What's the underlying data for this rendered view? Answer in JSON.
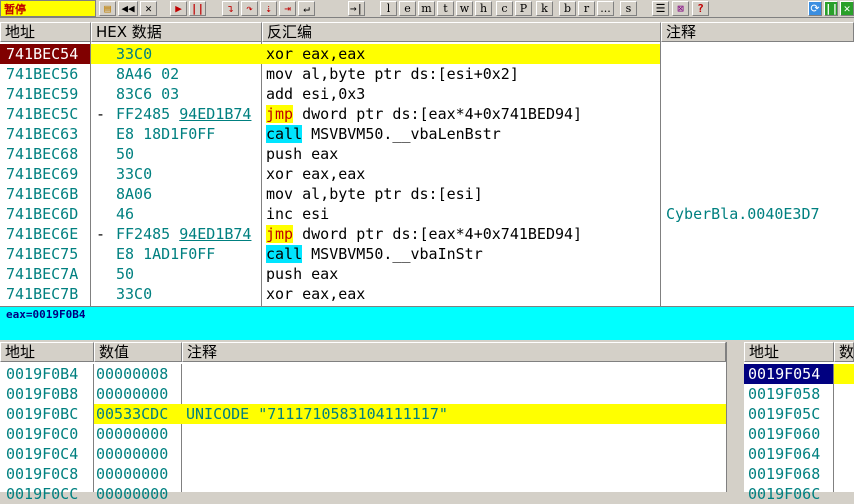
{
  "status_text": "暂停",
  "toolbar": {
    "buttons": [
      "open-icon",
      "rewind-icon",
      "close-icon",
      "run-icon",
      "pause-icon",
      "step-into-icon",
      "step-over-icon",
      "trace-into-icon",
      "trace-over-icon",
      "execute-till-return-icon",
      "go-to-icon"
    ],
    "letters": [
      "l",
      "e",
      "m",
      "t",
      "w",
      "h",
      "c",
      "P",
      "k",
      "b",
      "r",
      "...",
      "s"
    ],
    "right_buttons": [
      "list-icon",
      "grid-icon",
      "help-icon"
    ],
    "far_right": [
      "refresh-icon",
      "pause-icon-2",
      "close-icon-2"
    ],
    "help_label": "?"
  },
  "cpu": {
    "headers": {
      "addr": "地址",
      "hex": "HEX 数据",
      "disasm": "反汇编",
      "comment": "注释"
    },
    "rows": [
      {
        "addr": "741BEC54",
        "marker": "",
        "hex": "33C0",
        "hex_link": "",
        "instr": "xor eax,eax",
        "kw": "",
        "rest": "",
        "comment": "",
        "selected": true
      },
      {
        "addr": "741BEC56",
        "marker": "",
        "hex": "8A46 02",
        "hex_link": "",
        "instr": "mov al,byte ptr ds:[esi+0x2]",
        "kw": "",
        "rest": "",
        "comment": ""
      },
      {
        "addr": "741BEC59",
        "marker": "",
        "hex": "83C6 03",
        "hex_link": "",
        "instr": "add esi,0x3",
        "kw": "",
        "rest": "",
        "comment": ""
      },
      {
        "addr": "741BEC5C",
        "marker": "-",
        "hex": "FF2485",
        "hex_link": "94ED1B74",
        "instr": "",
        "kw": "jmp",
        "rest": " dword ptr ds:[eax*4+0x741BED94]",
        "comment": ""
      },
      {
        "addr": "741BEC63",
        "marker": "",
        "hex": "E8 18D1F0FF",
        "hex_link": "",
        "instr": "",
        "kw": "call",
        "rest": " MSVBVM50.__vbaLenBstr",
        "comment": ""
      },
      {
        "addr": "741BEC68",
        "marker": "",
        "hex": "50",
        "hex_link": "",
        "instr": "push eax",
        "kw": "",
        "rest": "",
        "comment": ""
      },
      {
        "addr": "741BEC69",
        "marker": "",
        "hex": "33C0",
        "hex_link": "",
        "instr": "xor eax,eax",
        "kw": "",
        "rest": "",
        "comment": ""
      },
      {
        "addr": "741BEC6B",
        "marker": "",
        "hex": "8A06",
        "hex_link": "",
        "instr": "mov al,byte ptr ds:[esi]",
        "kw": "",
        "rest": "",
        "comment": ""
      },
      {
        "addr": "741BEC6D",
        "marker": "",
        "hex": "46",
        "hex_link": "",
        "instr": "inc esi",
        "kw": "",
        "rest": "",
        "comment": "CyberBla.0040E3D7"
      },
      {
        "addr": "741BEC6E",
        "marker": "-",
        "hex": "FF2485",
        "hex_link": "94ED1B74",
        "instr": "",
        "kw": "jmp",
        "rest": " dword ptr ds:[eax*4+0x741BED94]",
        "comment": ""
      },
      {
        "addr": "741BEC75",
        "marker": "",
        "hex": "E8 1AD1F0FF",
        "hex_link": "",
        "instr": "",
        "kw": "call",
        "rest": " MSVBVM50.__vbaInStr",
        "comment": ""
      },
      {
        "addr": "741BEC7A",
        "marker": "",
        "hex": "50",
        "hex_link": "",
        "instr": "push eax",
        "kw": "",
        "rest": "",
        "comment": ""
      },
      {
        "addr": "741BEC7B",
        "marker": "",
        "hex": "33C0",
        "hex_link": "",
        "instr": "xor eax,eax",
        "kw": "",
        "rest": "",
        "comment": ""
      }
    ]
  },
  "info_text": "eax=0019F0B4",
  "dump": {
    "headers": {
      "addr": "地址",
      "value": "数值",
      "comment": "注释"
    },
    "rows": [
      {
        "addr": "0019F0B4",
        "value": "00000008",
        "comment": ""
      },
      {
        "addr": "0019F0B8",
        "value": "00000000",
        "comment": ""
      },
      {
        "addr": "0019F0BC",
        "value": "00533CDC",
        "comment": "UNICODE \"7111710583104111117\"",
        "selected": true
      },
      {
        "addr": "0019F0C0",
        "value": "00000000",
        "comment": ""
      },
      {
        "addr": "0019F0C4",
        "value": "00000000",
        "comment": ""
      },
      {
        "addr": "0019F0C8",
        "value": "00000000",
        "comment": ""
      },
      {
        "addr": "0019F0CC",
        "value": "00000000",
        "comment": ""
      }
    ]
  },
  "stack": {
    "headers": {
      "addr": "地址",
      "value": "数"
    },
    "rows": [
      {
        "addr": "0019F054",
        "selected": true
      },
      {
        "addr": "0019F058"
      },
      {
        "addr": "0019F05C"
      },
      {
        "addr": "0019F060"
      },
      {
        "addr": "0019F064"
      },
      {
        "addr": "0019F068"
      },
      {
        "addr": "0019F06C"
      }
    ]
  }
}
